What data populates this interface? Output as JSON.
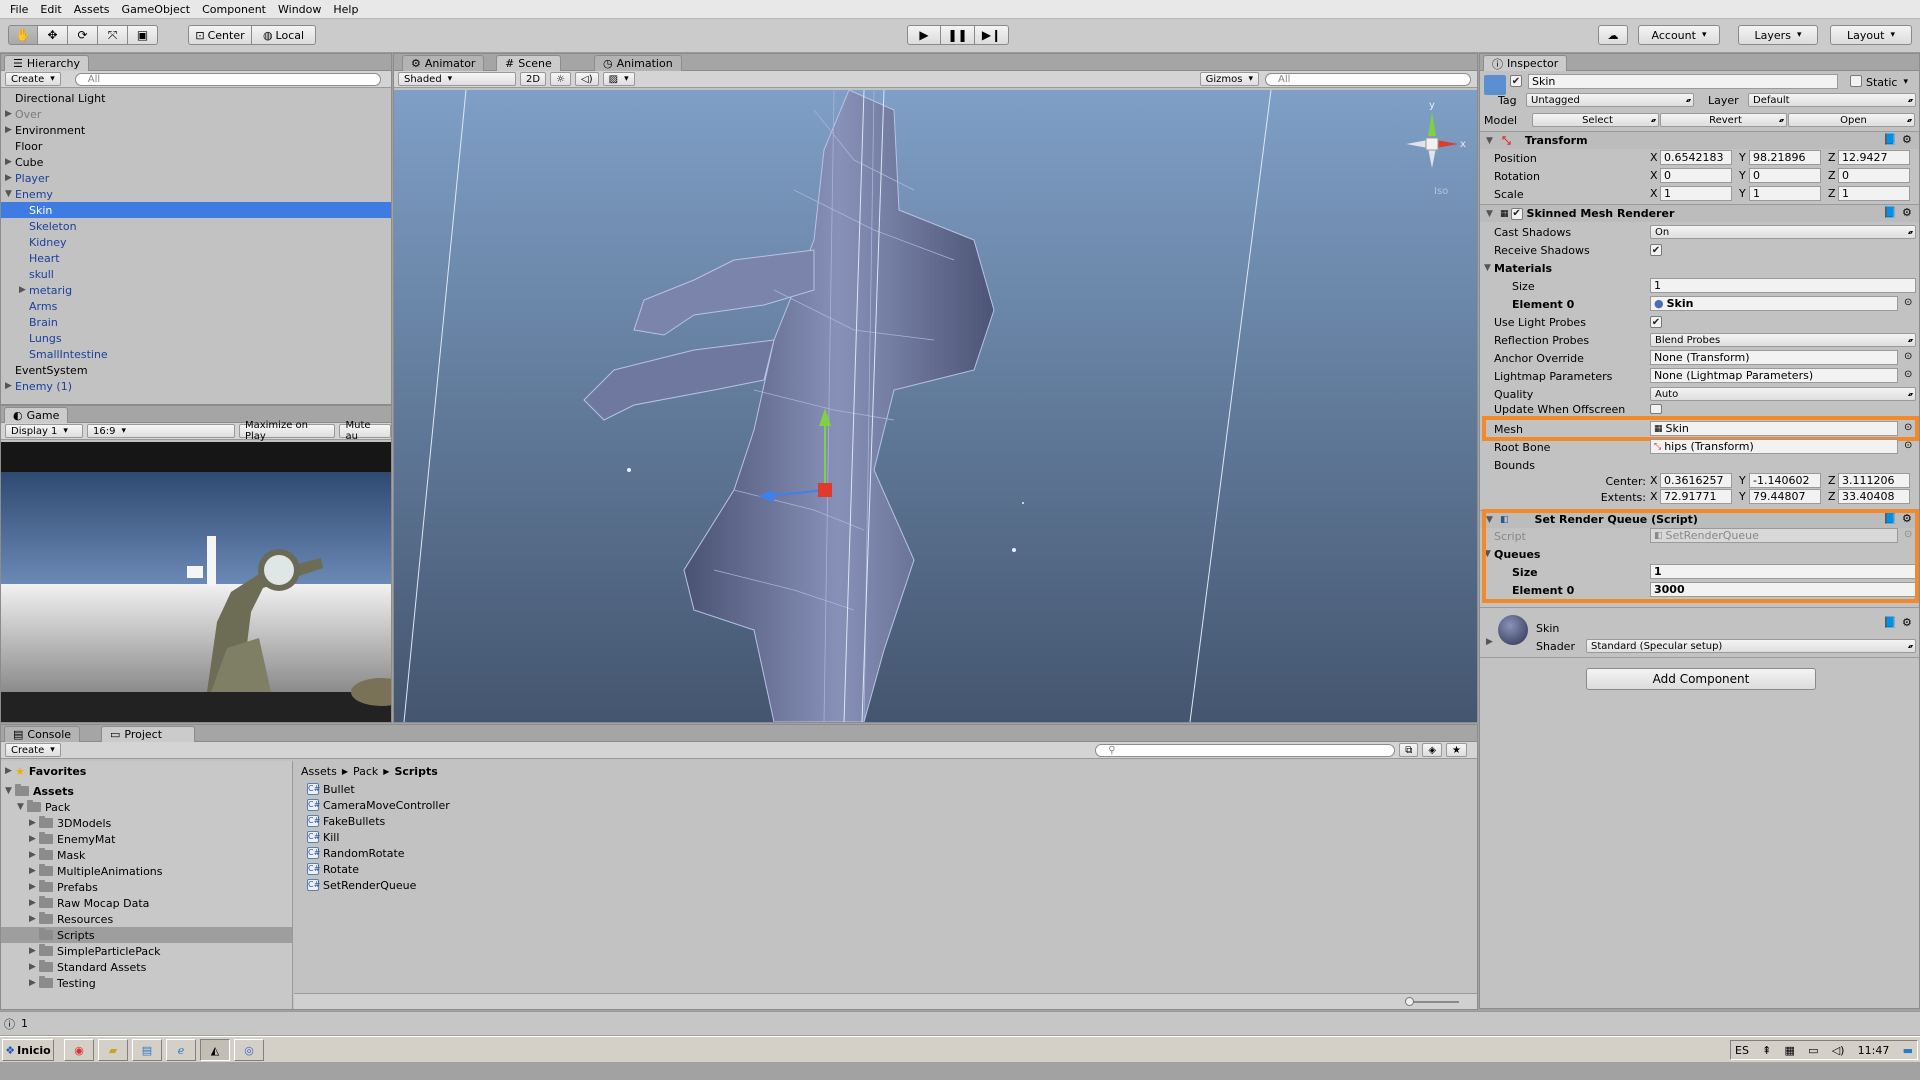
{
  "menu": [
    "File",
    "Edit",
    "Assets",
    "GameObject",
    "Component",
    "Window",
    "Help"
  ],
  "toolbar": {
    "pivot": "Center",
    "space": "Local",
    "account": "Account",
    "layers": "Layers",
    "layout": "Layout"
  },
  "hierarchy": {
    "tab": "Hierarchy",
    "create": "Create",
    "search_placeholder": "All",
    "items": [
      {
        "label": "Directional Light",
        "style": "normal",
        "indent": 0,
        "arrow": ""
      },
      {
        "label": "Over",
        "style": "gray",
        "indent": 0,
        "arrow": "▶"
      },
      {
        "label": "Environment",
        "style": "normal",
        "indent": 0,
        "arrow": "▶"
      },
      {
        "label": "Floor",
        "style": "normal",
        "indent": 0,
        "arrow": ""
      },
      {
        "label": "Cube",
        "style": "normal",
        "indent": 0,
        "arrow": "▶"
      },
      {
        "label": "Player",
        "style": "blue",
        "indent": 0,
        "arrow": "▶"
      },
      {
        "label": "Enemy",
        "style": "blue",
        "indent": 0,
        "arrow": "▼"
      },
      {
        "label": "Skin",
        "style": "selected",
        "indent": 1,
        "arrow": ""
      },
      {
        "label": "Skeleton",
        "style": "blue",
        "indent": 1,
        "arrow": ""
      },
      {
        "label": "Kidney",
        "style": "blue",
        "indent": 1,
        "arrow": ""
      },
      {
        "label": "Heart",
        "style": "blue",
        "indent": 1,
        "arrow": ""
      },
      {
        "label": "skull",
        "style": "blue",
        "indent": 1,
        "arrow": ""
      },
      {
        "label": "metarig",
        "style": "blue",
        "indent": 1,
        "arrow": "▶"
      },
      {
        "label": "Arms",
        "style": "blue",
        "indent": 1,
        "arrow": ""
      },
      {
        "label": "Brain",
        "style": "blue",
        "indent": 1,
        "arrow": ""
      },
      {
        "label": "Lungs",
        "style": "blue",
        "indent": 1,
        "arrow": ""
      },
      {
        "label": "SmallIntestine",
        "style": "blue",
        "indent": 1,
        "arrow": ""
      },
      {
        "label": "EventSystem",
        "style": "normal",
        "indent": 0,
        "arrow": ""
      },
      {
        "label": "Enemy (1)",
        "style": "blue",
        "indent": 0,
        "arrow": "▶"
      }
    ]
  },
  "game": {
    "tab": "Game",
    "display": "Display 1",
    "aspect": "16:9",
    "maximize": "Maximize on Play",
    "mute": "Mute au"
  },
  "scene": {
    "tabs": [
      "Animator",
      "Scene",
      "Animation"
    ],
    "shading": "Shaded",
    "mode_2d": "2D",
    "gizmos": "Gizmos",
    "search_placeholder": "All",
    "iso": "Iso",
    "axis_y": "y",
    "axis_x": "x"
  },
  "inspector": {
    "tab": "Inspector",
    "object_name": "Skin",
    "static": "Static",
    "tag_label": "Tag",
    "tag_value": "Untagged",
    "layer_label": "Layer",
    "layer_value": "Default",
    "model_label": "Model",
    "model_buttons": [
      "Select",
      "Revert",
      "Open"
    ],
    "transform": {
      "title": "Transform",
      "rows": [
        {
          "label": "Position",
          "x": "0.6542183",
          "y": "98.21896",
          "z": "12.9427"
        },
        {
          "label": "Rotation",
          "x": "0",
          "y": "0",
          "z": "0"
        },
        {
          "label": "Scale",
          "x": "1",
          "y": "1",
          "z": "1"
        }
      ]
    },
    "smr": {
      "title": "Skinned Mesh Renderer",
      "cast_shadows_label": "Cast Shadows",
      "cast_shadows": "On",
      "receive_shadows_label": "Receive Shadows",
      "materials_label": "Materials",
      "size_label": "Size",
      "size": "1",
      "element0_label": "Element 0",
      "element0": "Skin",
      "light_probes_label": "Use Light Probes",
      "reflection_probes_label": "Reflection Probes",
      "reflection_probes": "Blend Probes",
      "anchor_override_label": "Anchor Override",
      "anchor_override": "None (Transform)",
      "lightmap_params_label": "Lightmap Parameters",
      "lightmap_params": "None (Lightmap Parameters)",
      "quality_label": "Quality",
      "quality": "Auto",
      "update_offscreen_label": "Update When Offscreen",
      "mesh_label": "Mesh",
      "mesh": "Skin",
      "root_bone_label": "Root Bone",
      "root_bone": "hips (Transform)",
      "bounds_label": "Bounds",
      "center_label": "Center:",
      "center": {
        "x": "0.3616257",
        "y": "-1.140602",
        "z": "3.111206"
      },
      "extents_label": "Extents:",
      "extents": {
        "x": "72.91771",
        "y": "79.44807",
        "z": "33.40408"
      }
    },
    "srq": {
      "title": "Set Render Queue (Script)",
      "script_label": "Script",
      "script": "SetRenderQueue",
      "queues_label": "Queues",
      "size_label": "Size",
      "size": "1",
      "element0_label": "Element 0",
      "element0": "3000"
    },
    "material": {
      "name": "Skin",
      "shader_label": "Shader",
      "shader": "Standard (Specular setup)"
    },
    "add_component": "Add Component",
    "axis": [
      "X",
      "Y",
      "Z"
    ]
  },
  "bottom": {
    "tabs": [
      "Console",
      "Project"
    ],
    "create": "Create",
    "favorites": "Favorites",
    "assets": "Assets",
    "pack": "Pack",
    "folders": [
      "3DModels",
      "EnemyMat",
      "Mask",
      "MultipleAnimations",
      "Prefabs",
      "Raw Mocap Data",
      "Resources",
      "Scripts",
      "SimpleParticlePack",
      "Standard Assets",
      "Testing"
    ],
    "selected_folder": "Scripts",
    "breadcrumb": [
      "Assets",
      "Pack",
      "Scripts"
    ],
    "scripts": [
      "Bullet",
      "CameraMoveController",
      "FakeBullets",
      "Kill",
      "RandomRotate",
      "Rotate",
      "SetRenderQueue"
    ]
  },
  "status": {
    "text": "1"
  },
  "taskbar": {
    "start": "Inicio",
    "lang": "ES",
    "time": "11:47"
  },
  "colors": {
    "selection": "#3e7ce4",
    "highlight": "#f28a2c",
    "panel": "#c2c2c2"
  }
}
